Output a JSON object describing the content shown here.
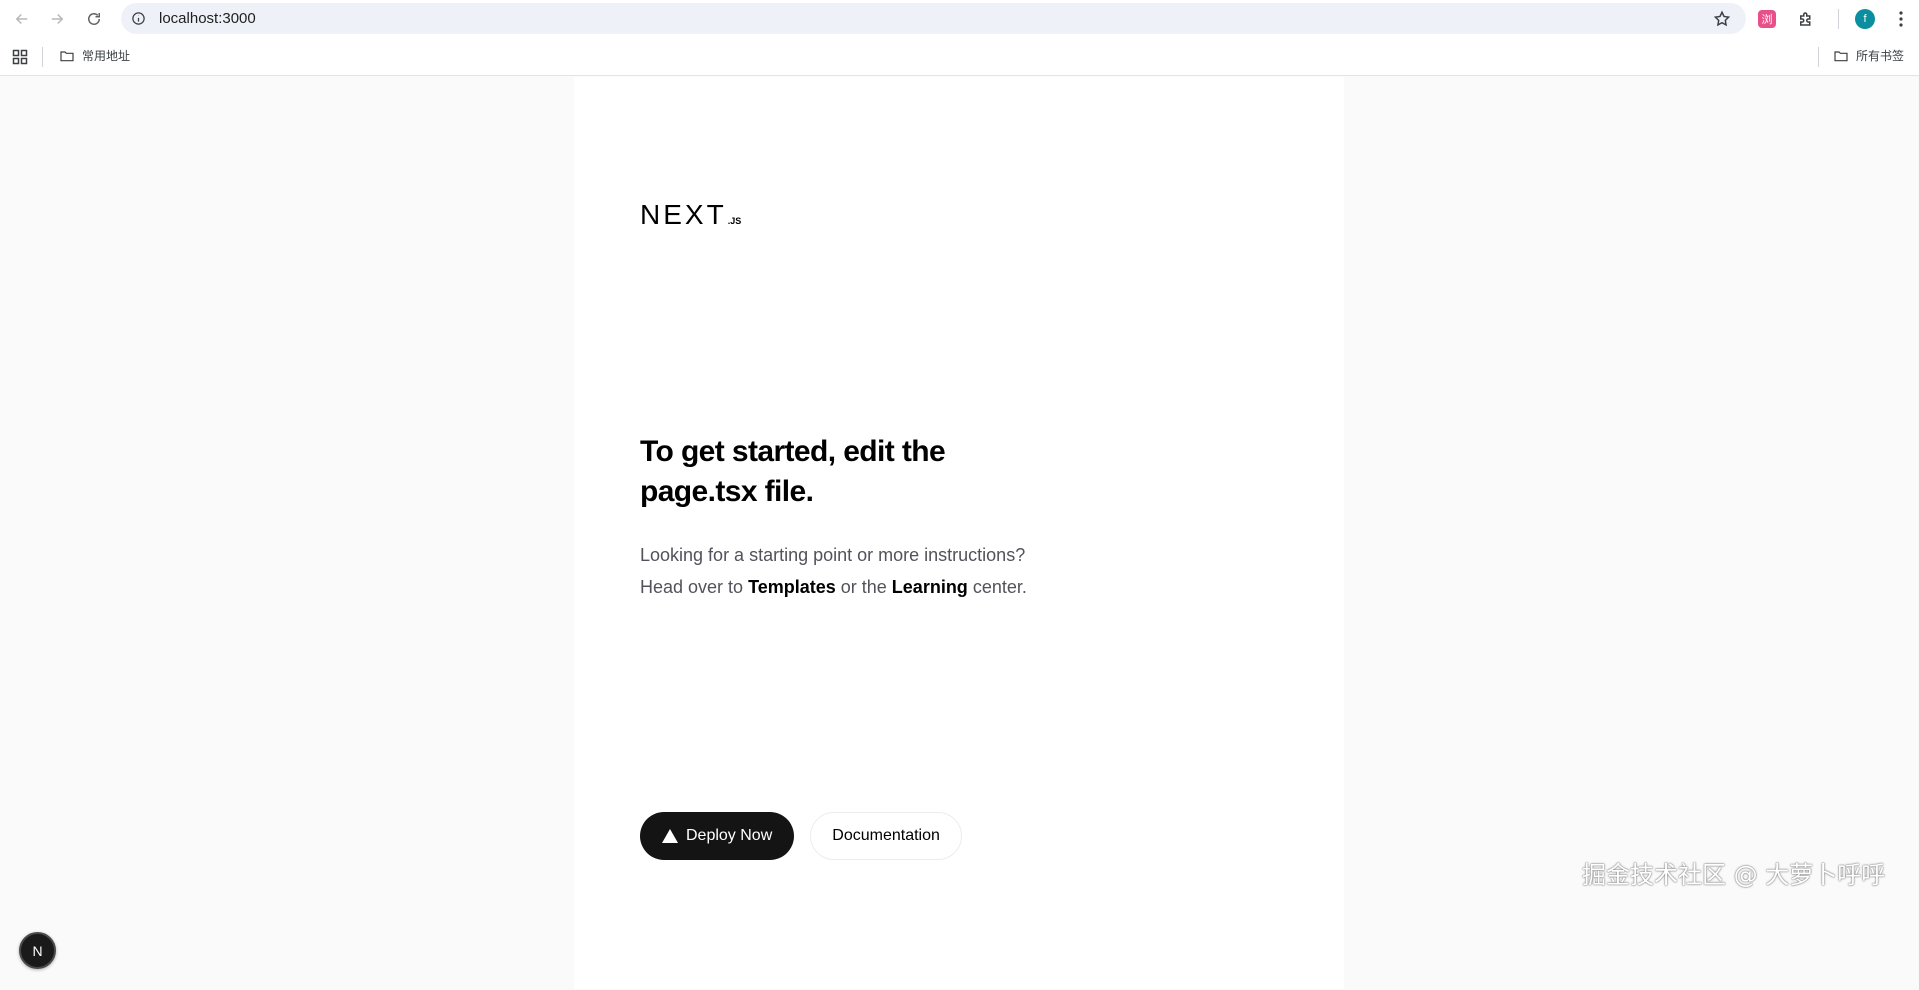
{
  "browser": {
    "url": "localhost:3000",
    "ext_badge_label": "浏",
    "profile_initial": "f",
    "bookmarks": {
      "left_folder": "常用地址",
      "right_folder": "所有书签"
    }
  },
  "page": {
    "logo": {
      "main": "NEXT",
      "suffix": ".JS"
    },
    "heading": "To get started, edit the page.tsx file.",
    "description": {
      "line1": "Looking for a starting point or more instructions?",
      "line2_prefix": "Head over to ",
      "templates_link": "Templates",
      "line2_mid": " or the ",
      "learning_link": "Learning",
      "line2_suffix": " center."
    },
    "buttons": {
      "deploy": "Deploy Now",
      "docs": "Documentation"
    },
    "dev_badge": "N"
  },
  "watermark": "掘金技术社区 @ 大萝卜呼呼"
}
